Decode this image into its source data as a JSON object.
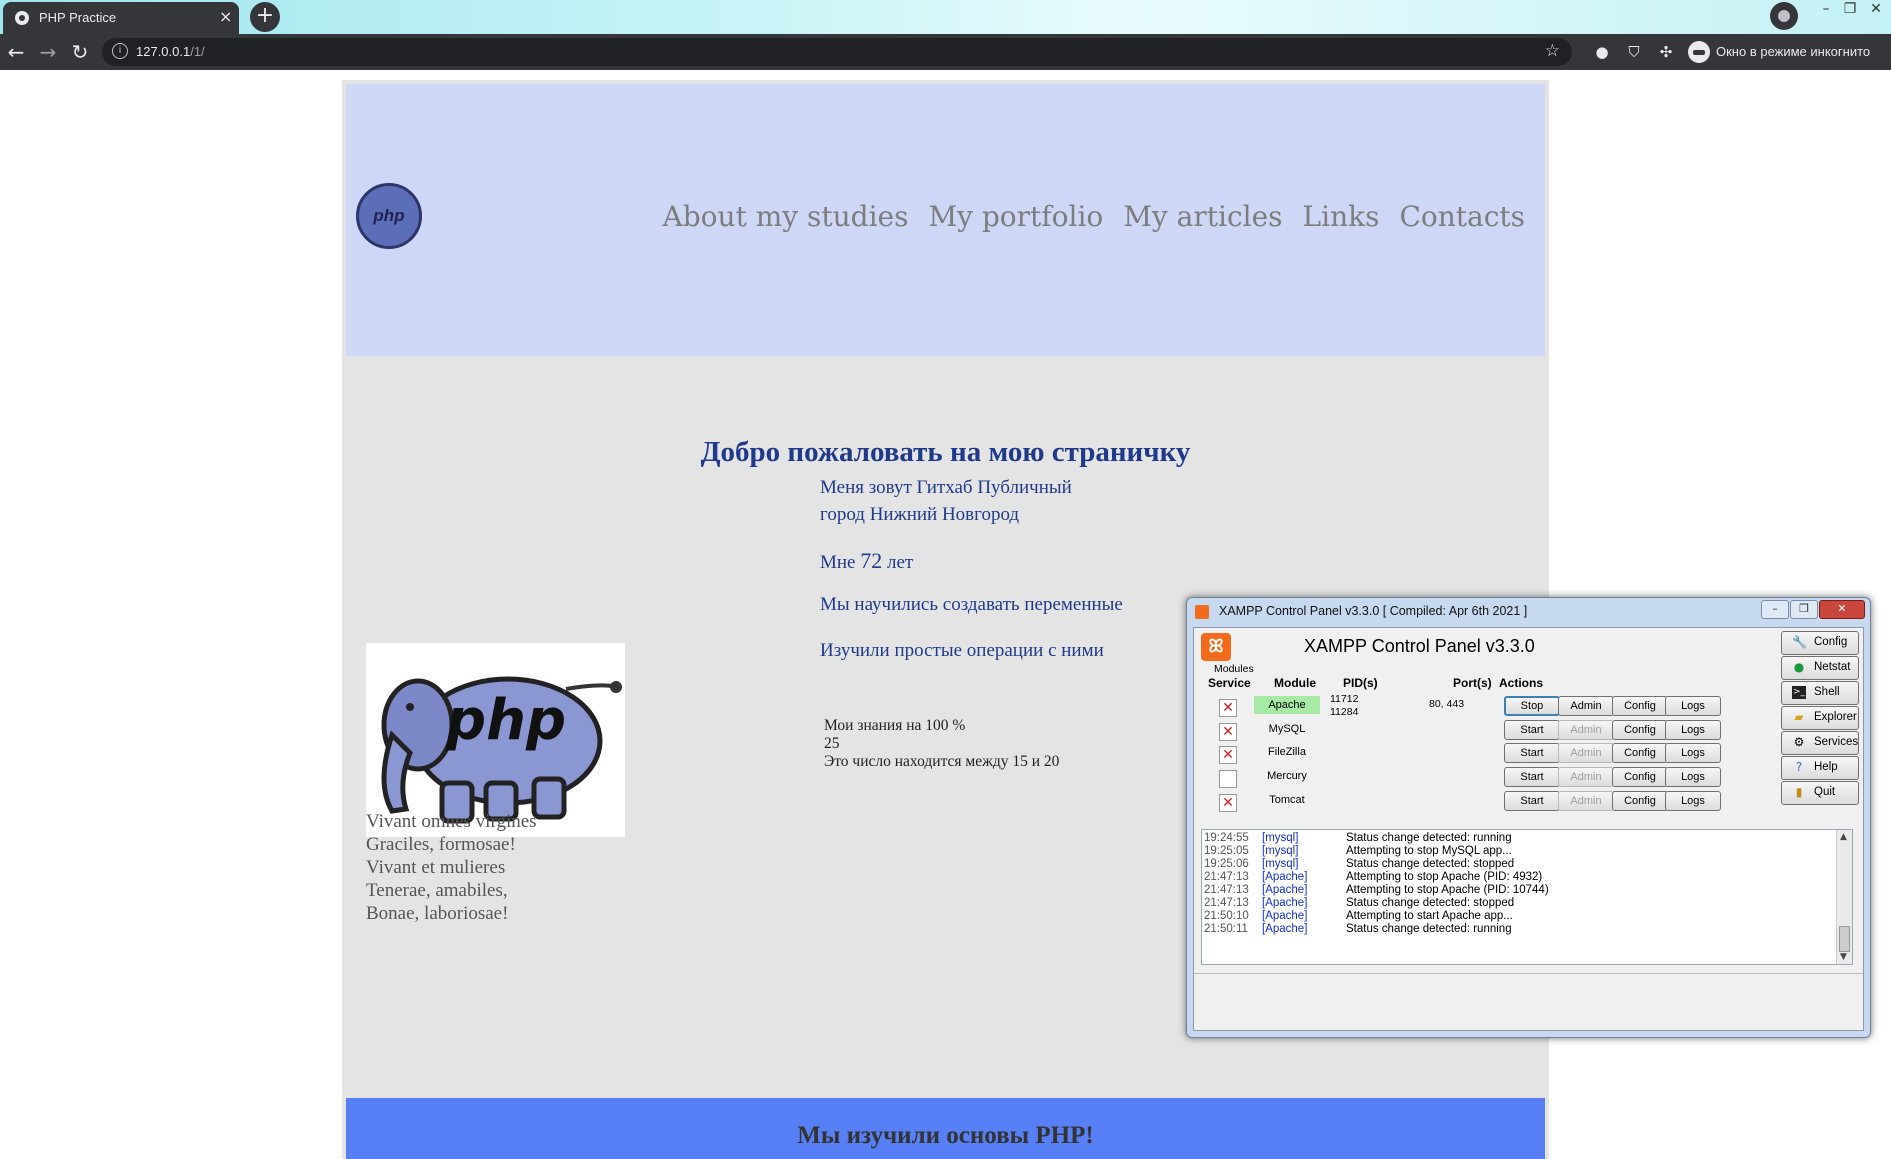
{
  "browser": {
    "tab_title": "PHP Practice",
    "tab_close": "×",
    "new_tab": "+",
    "url_host": "127.0.0.1",
    "url_path": "/1/",
    "info_glyph": "i",
    "star": "☆",
    "incognito_label": "Окно в режиме инкогнито",
    "back": "←",
    "forward": "→",
    "reload": "↻",
    "ext_icons": [
      "record-icon",
      "shield-icon",
      "puzzle-icon"
    ],
    "window_controls": [
      "–",
      "❐",
      "✕"
    ]
  },
  "site": {
    "logo_text": "php",
    "nav": [
      "About my studies",
      "My portfolio",
      "My articles",
      "Links",
      "Contacts"
    ],
    "welcome": "Добро пожаловать на мою страничку",
    "info": {
      "name_line": "Меня зовут Гитхаб Публичный",
      "city_line": "город Нижний Новгород",
      "age_prefix": "Мне ",
      "age_number": "72",
      "age_suffix": " лет",
      "vars_line": "Мы научились создавать переменные",
      "ops_line": "Изучили простые операции с ними"
    },
    "knowledge": {
      "line1": "Мои знания на 100 %",
      "line2": "25",
      "line3": "Это число находится между 15 и 20"
    },
    "poem": [
      "Vivant omnes virgines",
      "Graciles, formosae!",
      "Vivant et mulieres",
      "Tenerae, amabiles,",
      "Bonae, laboriosae!"
    ],
    "footer": "Мы изучили основы PHP!",
    "colors": {
      "header_bg": "#cfd7f6",
      "page_bg": "#e4e4e4",
      "footer_bg": "#577ff6",
      "heading": "#1f3a8a"
    }
  },
  "xampp": {
    "title": "XAMPP Control Panel v3.3.0   [ Compiled: Apr 6th 2021 ]",
    "heading": "XAMPP Control Panel v3.3.0",
    "modules_label": "Modules",
    "headers": {
      "service": "Service",
      "module": "Module",
      "pids": "PID(s)",
      "ports": "Port(s)",
      "actions": "Actions"
    },
    "side_buttons": [
      {
        "label": "Config",
        "icon": "wrench-icon"
      },
      {
        "label": "Netstat",
        "icon": "globe-icon"
      },
      {
        "label": "Shell",
        "icon": "terminal-icon"
      },
      {
        "label": "Explorer",
        "icon": "folder-icon"
      },
      {
        "label": "Services",
        "icon": "services-icon"
      },
      {
        "label": "Help",
        "icon": "help-icon"
      },
      {
        "label": "Quit",
        "icon": "quit-icon"
      }
    ],
    "modules": [
      {
        "name": "Apache",
        "service": "✕",
        "running": true,
        "pid1": "11712",
        "pid2": "11284",
        "ports": "80, 443",
        "action": "Stop",
        "admin": "Admin",
        "config": "Config",
        "logs": "Logs"
      },
      {
        "name": "MySQL",
        "service": "✕",
        "running": false,
        "pid1": "",
        "pid2": "",
        "ports": "",
        "action": "Start",
        "admin": "Admin",
        "config": "Config",
        "logs": "Logs"
      },
      {
        "name": "FileZilla",
        "service": "✕",
        "running": false,
        "pid1": "",
        "pid2": "",
        "ports": "",
        "action": "Start",
        "admin": "Admin",
        "config": "Config",
        "logs": "Logs"
      },
      {
        "name": "Mercury",
        "service": "",
        "running": false,
        "pid1": "",
        "pid2": "",
        "ports": "",
        "action": "Start",
        "admin": "Admin",
        "config": "Config",
        "logs": "Logs"
      },
      {
        "name": "Tomcat",
        "service": "✕",
        "running": false,
        "pid1": "",
        "pid2": "",
        "ports": "",
        "action": "Start",
        "admin": "Admin",
        "config": "Config",
        "logs": "Logs"
      }
    ],
    "log": [
      {
        "time": "19:24:55",
        "module": "[mysql]",
        "message": "Status change detected: running"
      },
      {
        "time": "19:25:05",
        "module": "[mysql]",
        "message": "Attempting to stop MySQL app..."
      },
      {
        "time": "19:25:06",
        "module": "[mysql]",
        "message": "Status change detected: stopped"
      },
      {
        "time": "21:47:13",
        "module": "[Apache]",
        "message": "Attempting to stop Apache (PID: 4932)"
      },
      {
        "time": "21:47:13",
        "module": "[Apache]",
        "message": "Attempting to stop Apache (PID: 10744)"
      },
      {
        "time": "21:47:13",
        "module": "[Apache]",
        "message": "Status change detected: stopped"
      },
      {
        "time": "21:50:10",
        "module": "[Apache]",
        "message": "Attempting to start Apache app..."
      },
      {
        "time": "21:50:11",
        "module": "[Apache]",
        "message": "Status change detected: running"
      }
    ]
  }
}
